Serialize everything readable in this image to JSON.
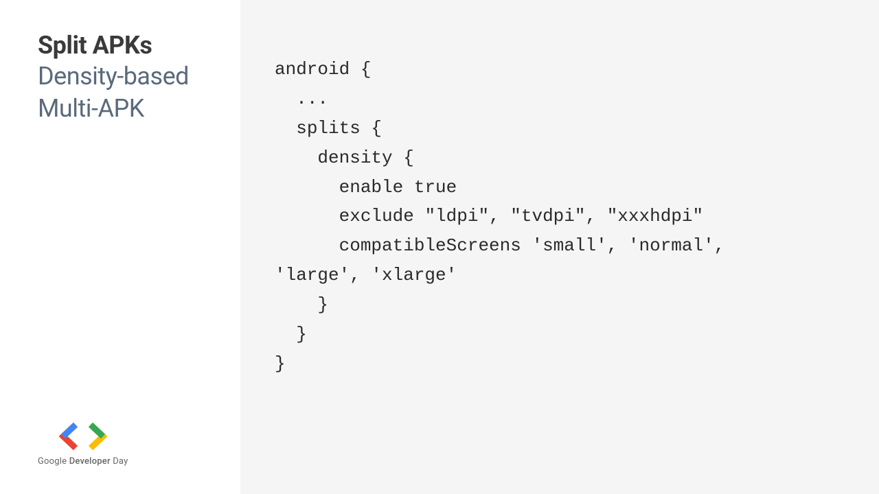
{
  "sidebar": {
    "title_bold": "Split APKs",
    "title_light_line1": "Density-based",
    "title_light_line2": "Multi-APK"
  },
  "logo": {
    "text_google": "Google",
    "text_developer": "Developer",
    "text_day": "Day"
  },
  "code": {
    "content": "android {\n  ...\n  splits {\n    density {\n      enable true\n      exclude \"ldpi\", \"tvdpi\", \"xxxhdpi\"\n      compatibleScreens 'small', 'normal',\n'large', 'xlarge'\n    }\n  }\n}"
  }
}
